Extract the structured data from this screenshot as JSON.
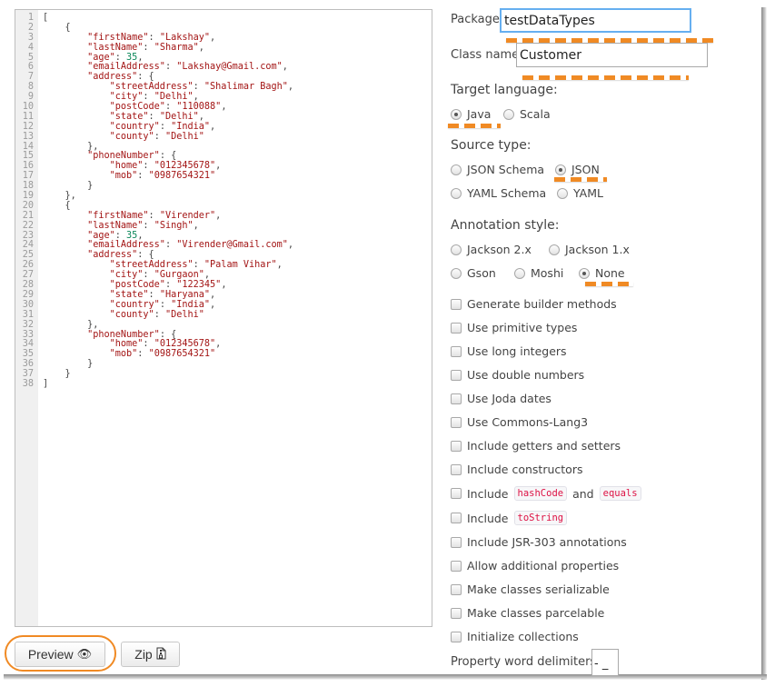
{
  "editor": {
    "lines": [
      {
        "n": "1",
        "indent": "",
        "parts": [
          [
            "p",
            "["
          ]
        ]
      },
      {
        "n": "2",
        "indent": "    ",
        "parts": [
          [
            "p",
            "{"
          ]
        ]
      },
      {
        "n": "3",
        "indent": "        ",
        "parts": [
          [
            "k",
            "\"firstName\""
          ],
          [
            "p",
            ": "
          ],
          [
            "s",
            "\"Lakshay\""
          ],
          [
            "p",
            ","
          ]
        ]
      },
      {
        "n": "4",
        "indent": "        ",
        "parts": [
          [
            "k",
            "\"lastName\""
          ],
          [
            "p",
            ": "
          ],
          [
            "s",
            "\"Sharma\""
          ],
          [
            "p",
            ","
          ]
        ]
      },
      {
        "n": "5",
        "indent": "        ",
        "parts": [
          [
            "k",
            "\"age\""
          ],
          [
            "p",
            ": "
          ],
          [
            "n",
            "35"
          ],
          [
            "p",
            ","
          ]
        ]
      },
      {
        "n": "6",
        "indent": "        ",
        "parts": [
          [
            "k",
            "\"emailAddress\""
          ],
          [
            "p",
            ": "
          ],
          [
            "s",
            "\"Lakshay@Gmail.com\""
          ],
          [
            "p",
            ","
          ]
        ]
      },
      {
        "n": "7",
        "indent": "        ",
        "parts": [
          [
            "k",
            "\"address\""
          ],
          [
            "p",
            ": {"
          ]
        ]
      },
      {
        "n": "8",
        "indent": "            ",
        "parts": [
          [
            "k",
            "\"streetAddress\""
          ],
          [
            "p",
            ": "
          ],
          [
            "s",
            "\"Shalimar Bagh\""
          ],
          [
            "p",
            ","
          ]
        ]
      },
      {
        "n": "9",
        "indent": "            ",
        "parts": [
          [
            "k",
            "\"city\""
          ],
          [
            "p",
            ": "
          ],
          [
            "s",
            "\"Delhi\""
          ],
          [
            "p",
            ","
          ]
        ]
      },
      {
        "n": "10",
        "indent": "            ",
        "parts": [
          [
            "k",
            "\"postCode\""
          ],
          [
            "p",
            ": "
          ],
          [
            "s",
            "\"110088\""
          ],
          [
            "p",
            ","
          ]
        ]
      },
      {
        "n": "11",
        "indent": "            ",
        "parts": [
          [
            "k",
            "\"state\""
          ],
          [
            "p",
            ": "
          ],
          [
            "s",
            "\"Delhi\""
          ],
          [
            "p",
            ","
          ]
        ]
      },
      {
        "n": "12",
        "indent": "            ",
        "parts": [
          [
            "k",
            "\"country\""
          ],
          [
            "p",
            ": "
          ],
          [
            "s",
            "\"India\""
          ],
          [
            "p",
            ","
          ]
        ]
      },
      {
        "n": "13",
        "indent": "            ",
        "parts": [
          [
            "k",
            "\"county\""
          ],
          [
            "p",
            ": "
          ],
          [
            "s",
            "\"Delhi\""
          ]
        ]
      },
      {
        "n": "14",
        "indent": "        ",
        "parts": [
          [
            "p",
            "},"
          ]
        ]
      },
      {
        "n": "15",
        "indent": "        ",
        "parts": [
          [
            "k",
            "\"phoneNumber\""
          ],
          [
            "p",
            ": {"
          ]
        ]
      },
      {
        "n": "16",
        "indent": "            ",
        "parts": [
          [
            "k",
            "\"home\""
          ],
          [
            "p",
            ": "
          ],
          [
            "s",
            "\"012345678\""
          ],
          [
            "p",
            ","
          ]
        ]
      },
      {
        "n": "17",
        "indent": "            ",
        "parts": [
          [
            "k",
            "\"mob\""
          ],
          [
            "p",
            ": "
          ],
          [
            "s",
            "\"0987654321\""
          ]
        ]
      },
      {
        "n": "18",
        "indent": "        ",
        "parts": [
          [
            "p",
            "}"
          ]
        ]
      },
      {
        "n": "19",
        "indent": "    ",
        "parts": [
          [
            "p",
            "},"
          ]
        ]
      },
      {
        "n": "20",
        "indent": "    ",
        "parts": [
          [
            "p",
            "{"
          ]
        ]
      },
      {
        "n": "21",
        "indent": "        ",
        "parts": [
          [
            "k",
            "\"firstName\""
          ],
          [
            "p",
            ": "
          ],
          [
            "s",
            "\"Virender\""
          ],
          [
            "p",
            ","
          ]
        ]
      },
      {
        "n": "22",
        "indent": "        ",
        "parts": [
          [
            "k",
            "\"lastName\""
          ],
          [
            "p",
            ": "
          ],
          [
            "s",
            "\"Singh\""
          ],
          [
            "p",
            ","
          ]
        ]
      },
      {
        "n": "23",
        "indent": "        ",
        "parts": [
          [
            "k",
            "\"age\""
          ],
          [
            "p",
            ": "
          ],
          [
            "n",
            "35"
          ],
          [
            "p",
            ","
          ]
        ]
      },
      {
        "n": "24",
        "indent": "        ",
        "parts": [
          [
            "k",
            "\"emailAddress\""
          ],
          [
            "p",
            ": "
          ],
          [
            "s",
            "\"Virender@Gmail.com\""
          ],
          [
            "p",
            ","
          ]
        ]
      },
      {
        "n": "25",
        "indent": "        ",
        "parts": [
          [
            "k",
            "\"address\""
          ],
          [
            "p",
            ": {"
          ]
        ]
      },
      {
        "n": "26",
        "indent": "            ",
        "parts": [
          [
            "k",
            "\"streetAddress\""
          ],
          [
            "p",
            ": "
          ],
          [
            "s",
            "\"Palam Vihar\""
          ],
          [
            "p",
            ","
          ]
        ]
      },
      {
        "n": "27",
        "indent": "            ",
        "parts": [
          [
            "k",
            "\"city\""
          ],
          [
            "p",
            ": "
          ],
          [
            "s",
            "\"Gurgaon\""
          ],
          [
            "p",
            ","
          ]
        ]
      },
      {
        "n": "28",
        "indent": "            ",
        "parts": [
          [
            "k",
            "\"postCode\""
          ],
          [
            "p",
            ": "
          ],
          [
            "s",
            "\"122345\""
          ],
          [
            "p",
            ","
          ]
        ]
      },
      {
        "n": "29",
        "indent": "            ",
        "parts": [
          [
            "k",
            "\"state\""
          ],
          [
            "p",
            ": "
          ],
          [
            "s",
            "\"Haryana\""
          ],
          [
            "p",
            ","
          ]
        ]
      },
      {
        "n": "30",
        "indent": "            ",
        "parts": [
          [
            "k",
            "\"country\""
          ],
          [
            "p",
            ": "
          ],
          [
            "s",
            "\"India\""
          ],
          [
            "p",
            ","
          ]
        ]
      },
      {
        "n": "31",
        "indent": "            ",
        "parts": [
          [
            "k",
            "\"county\""
          ],
          [
            "p",
            ": "
          ],
          [
            "s",
            "\"Delhi\""
          ]
        ]
      },
      {
        "n": "32",
        "indent": "        ",
        "parts": [
          [
            "p",
            "},"
          ]
        ]
      },
      {
        "n": "33",
        "indent": "        ",
        "parts": [
          [
            "k",
            "\"phoneNumber\""
          ],
          [
            "p",
            ": {"
          ]
        ]
      },
      {
        "n": "34",
        "indent": "            ",
        "parts": [
          [
            "k",
            "\"home\""
          ],
          [
            "p",
            ": "
          ],
          [
            "s",
            "\"012345678\""
          ],
          [
            "p",
            ","
          ]
        ]
      },
      {
        "n": "35",
        "indent": "            ",
        "parts": [
          [
            "k",
            "\"mob\""
          ],
          [
            "p",
            ": "
          ],
          [
            "s",
            "\"0987654321\""
          ]
        ]
      },
      {
        "n": "36",
        "indent": "        ",
        "parts": [
          [
            "p",
            "}"
          ]
        ]
      },
      {
        "n": "37",
        "indent": "    ",
        "parts": [
          [
            "p",
            "}"
          ]
        ]
      },
      {
        "n": "38",
        "indent": "",
        "parts": [
          [
            "p",
            "]"
          ]
        ]
      }
    ]
  },
  "buttons": {
    "preview_label": "Preview",
    "preview_icon": "👁",
    "zip_label": "Zip",
    "zip_icon": "🗜"
  },
  "form": {
    "package_label": "Package",
    "package_value": "testDataTypes",
    "classname_label": "Class name",
    "classname_value": "Customer",
    "target_language": {
      "title": "Target language:",
      "options": [
        {
          "label": "Java",
          "checked": true
        },
        {
          "label": "Scala",
          "checked": false
        }
      ]
    },
    "source_type": {
      "title": "Source type:",
      "options": [
        {
          "label": "JSON Schema",
          "checked": false
        },
        {
          "label": "JSON",
          "checked": true
        },
        {
          "label": "YAML Schema",
          "checked": false
        },
        {
          "label": "YAML",
          "checked": false
        }
      ]
    },
    "annotation_style": {
      "title": "Annotation style:",
      "options": [
        {
          "label": "Jackson 2.x",
          "checked": false
        },
        {
          "label": "Jackson 1.x",
          "checked": false
        },
        {
          "label": "Gson",
          "checked": false
        },
        {
          "label": "Moshi",
          "checked": false
        },
        {
          "label": "None",
          "checked": true
        }
      ]
    },
    "checkboxes": [
      {
        "label": "Generate builder methods",
        "checked": false
      },
      {
        "label": "Use primitive types",
        "checked": false
      },
      {
        "label": "Use long integers",
        "checked": false
      },
      {
        "label": "Use double numbers",
        "checked": false
      },
      {
        "label": "Use Joda dates",
        "checked": false
      },
      {
        "label": "Use Commons-Lang3",
        "checked": false
      },
      {
        "label": "Include getters and setters",
        "checked": false
      },
      {
        "label": "Include constructors",
        "checked": false
      }
    ],
    "hashcode_equals": {
      "prefix": "Include",
      "code1": "hashCode",
      "mid": "and",
      "code2": "equals",
      "checked": false
    },
    "tostring": {
      "prefix": "Include",
      "code": "toString",
      "checked": false
    },
    "checkboxes_after": [
      {
        "label": "Include JSR-303 annotations",
        "checked": false
      },
      {
        "label": "Allow additional properties",
        "checked": false
      },
      {
        "label": "Make classes serializable",
        "checked": false
      },
      {
        "label": "Make classes parcelable",
        "checked": false
      },
      {
        "label": "Initialize collections",
        "checked": false
      }
    ],
    "delimiters_label": "Property word delimiters:",
    "delimiters_value": "- _"
  },
  "colors": {
    "annotation_orange": "#f08a24",
    "focus_blue": "#66aff0",
    "json_key": "#a31515",
    "json_number": "#098658",
    "code_chip": "#dd1144"
  }
}
